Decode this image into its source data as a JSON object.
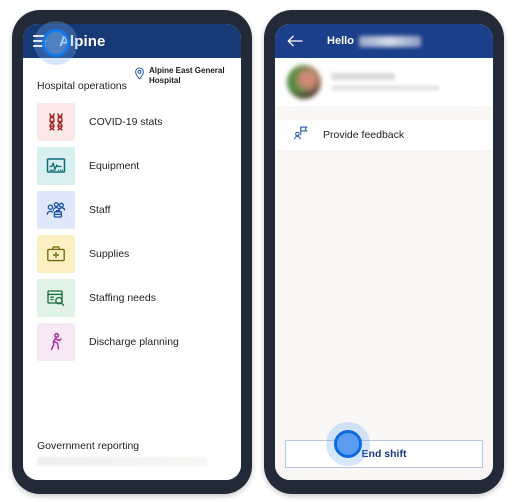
{
  "left_phone": {
    "app_bar": {
      "menu_icon": "hamburger-icon",
      "brand": "Alpine"
    },
    "location": {
      "pin_icon": "location-pin-icon",
      "name": "Alpine East General Hospital"
    },
    "section_title": "Hospital operations",
    "operations": [
      {
        "label": "COVID-19 stats",
        "icon": "dna-helix-icon",
        "tile_bg": "#fbe9e7",
        "icon_color": "#a4262c"
      },
      {
        "label": "Equipment",
        "icon": "vitals-monitor-icon",
        "tile_bg": "#d9f0f1",
        "icon_color": "#0f6b74"
      },
      {
        "label": "Staff",
        "icon": "people-group-icon",
        "tile_bg": "#dfe7fb",
        "icon_color": "#1b4fa0"
      },
      {
        "label": "Supplies",
        "icon": "medical-kit-icon",
        "tile_bg": "#fbf0c4",
        "icon_color": "#7a6a12"
      },
      {
        "label": "Staffing needs",
        "icon": "form-search-icon",
        "tile_bg": "#e1f2e6",
        "icon_color": "#176b3a"
      },
      {
        "label": "Discharge planning",
        "icon": "walking-person-icon",
        "tile_bg": "#f7e8f5",
        "icon_color": "#a4329c"
      }
    ],
    "footer": {
      "label": "Government reporting",
      "redacted_bar": "redacted"
    }
  },
  "right_phone": {
    "app_bar": {
      "back_icon": "back-arrow-icon",
      "greeting": "Hello",
      "user_name_redacted": "redacted"
    },
    "profile": {
      "avatar": "user-avatar-blurred",
      "name_redacted": "redacted",
      "detail_redacted": "redacted"
    },
    "menu": [
      {
        "label": "Provide  feedback",
        "icon": "feedback-person-icon"
      }
    ],
    "end_shift_button": "End shift"
  },
  "cursors": [
    {
      "name": "tap-cursor-left",
      "target": "hamburger-menu"
    },
    {
      "name": "tap-cursor-right",
      "target": "end-shift-button"
    }
  ],
  "colors": {
    "left_appbar": "#173a77",
    "right_appbar": "#1b3f8b",
    "phone_frame": "#222a37",
    "page_bg": "#f8f7f6",
    "cursor_ring": "#1277e8"
  }
}
